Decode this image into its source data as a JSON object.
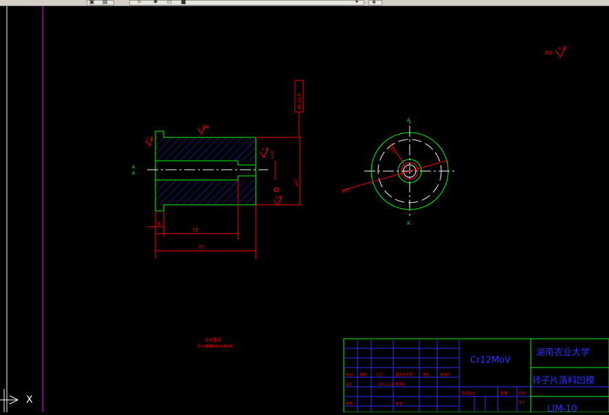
{
  "toolbar": {
    "layer_field": "",
    "layer_dropdown_icon": "chevron-down-icon"
  },
  "part": {
    "dim_6": "6",
    "dim_58": "58",
    "dim_70": "70",
    "dim_bore": "⌀10 ",
    "dim_outer": "⌀47 ",
    "dim_holes": "⌀55 ",
    "section_left_top": "A",
    "section_left_bottom": "A",
    "section_top": "A",
    "section_bottom": "A",
    "roughness_a": "0.4",
    "roughness_b": "0.8",
    "roughness_c": "1.6",
    "roughness_d": "1.6",
    "roughness_e": "0.8",
    "roughness_global": "6.3",
    "tolerance_frame": "⌀0.02 A"
  },
  "notes": {
    "title": "技术要求",
    "line1": "淬火硬度60-63HRC"
  },
  "title_block": {
    "material": "Cr12MoV",
    "university": "湖南农业大学",
    "part_name": "转子片落料凹模",
    "drawing_no": "LJM-10",
    "scale_label": "1:1",
    "row_labels": [
      "标记",
      "处数",
      "分区",
      "更改文件号",
      "签名",
      "年月日"
    ],
    "row2_labels": [
      "设计",
      "",
      "",
      "标准化",
      "",
      ""
    ],
    "row3_labels": [
      "审核",
      "",
      "",
      "批准",
      ""
    ],
    "stage_labels": [
      "阶段标记",
      "重量",
      "比例"
    ],
    "date_text": "2012.5.1"
  },
  "ucs": {
    "x_label": "X"
  }
}
